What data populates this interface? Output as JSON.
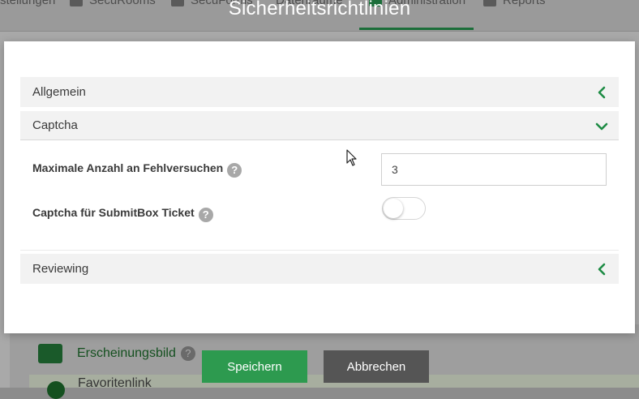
{
  "background": {
    "nav": [
      {
        "label": "Einstellungen",
        "shown": "stellungen",
        "icon": "settings-icon"
      },
      {
        "label": "SecuRooms",
        "icon": "mail-icon"
      },
      {
        "label": "SecuForms",
        "icon": "form-icon"
      },
      {
        "label": "Datenräume",
        "shown": "Datenräume",
        "icon": "folder-icon"
      },
      {
        "label": "Administration",
        "icon": "admin-icon",
        "active": true
      },
      {
        "label": "Reports",
        "icon": "list-icon"
      }
    ],
    "rows": [
      {
        "label": "Erscheinungsbild",
        "icon": "image-icon"
      },
      {
        "label": "Favoritenlink",
        "icon": "circle-icon"
      }
    ]
  },
  "dialog": {
    "title": "Sicherheitsrichtlinien",
    "sections": {
      "general": {
        "label": "Allgemein",
        "state": "collapsed"
      },
      "captcha": {
        "label": "Captcha",
        "state": "expanded",
        "fields": {
          "max_attempts": {
            "label": "Maximale Anzahl an Fehlversuchen",
            "value": "3",
            "help": "?"
          },
          "submitbox": {
            "label": "Captcha für SubmitBox Ticket",
            "enabled": false,
            "help": "?"
          }
        }
      },
      "reviewing": {
        "label": "Reviewing",
        "state": "collapsed"
      }
    },
    "buttons": {
      "save": "Speichern",
      "cancel": "Abbrechen"
    }
  },
  "colors": {
    "accent": "#2d9a4f",
    "chevron": "#1e8c45",
    "cancel": "#555555",
    "header_bg": "#f2f2f2",
    "overlay": "#a9a9a9"
  }
}
